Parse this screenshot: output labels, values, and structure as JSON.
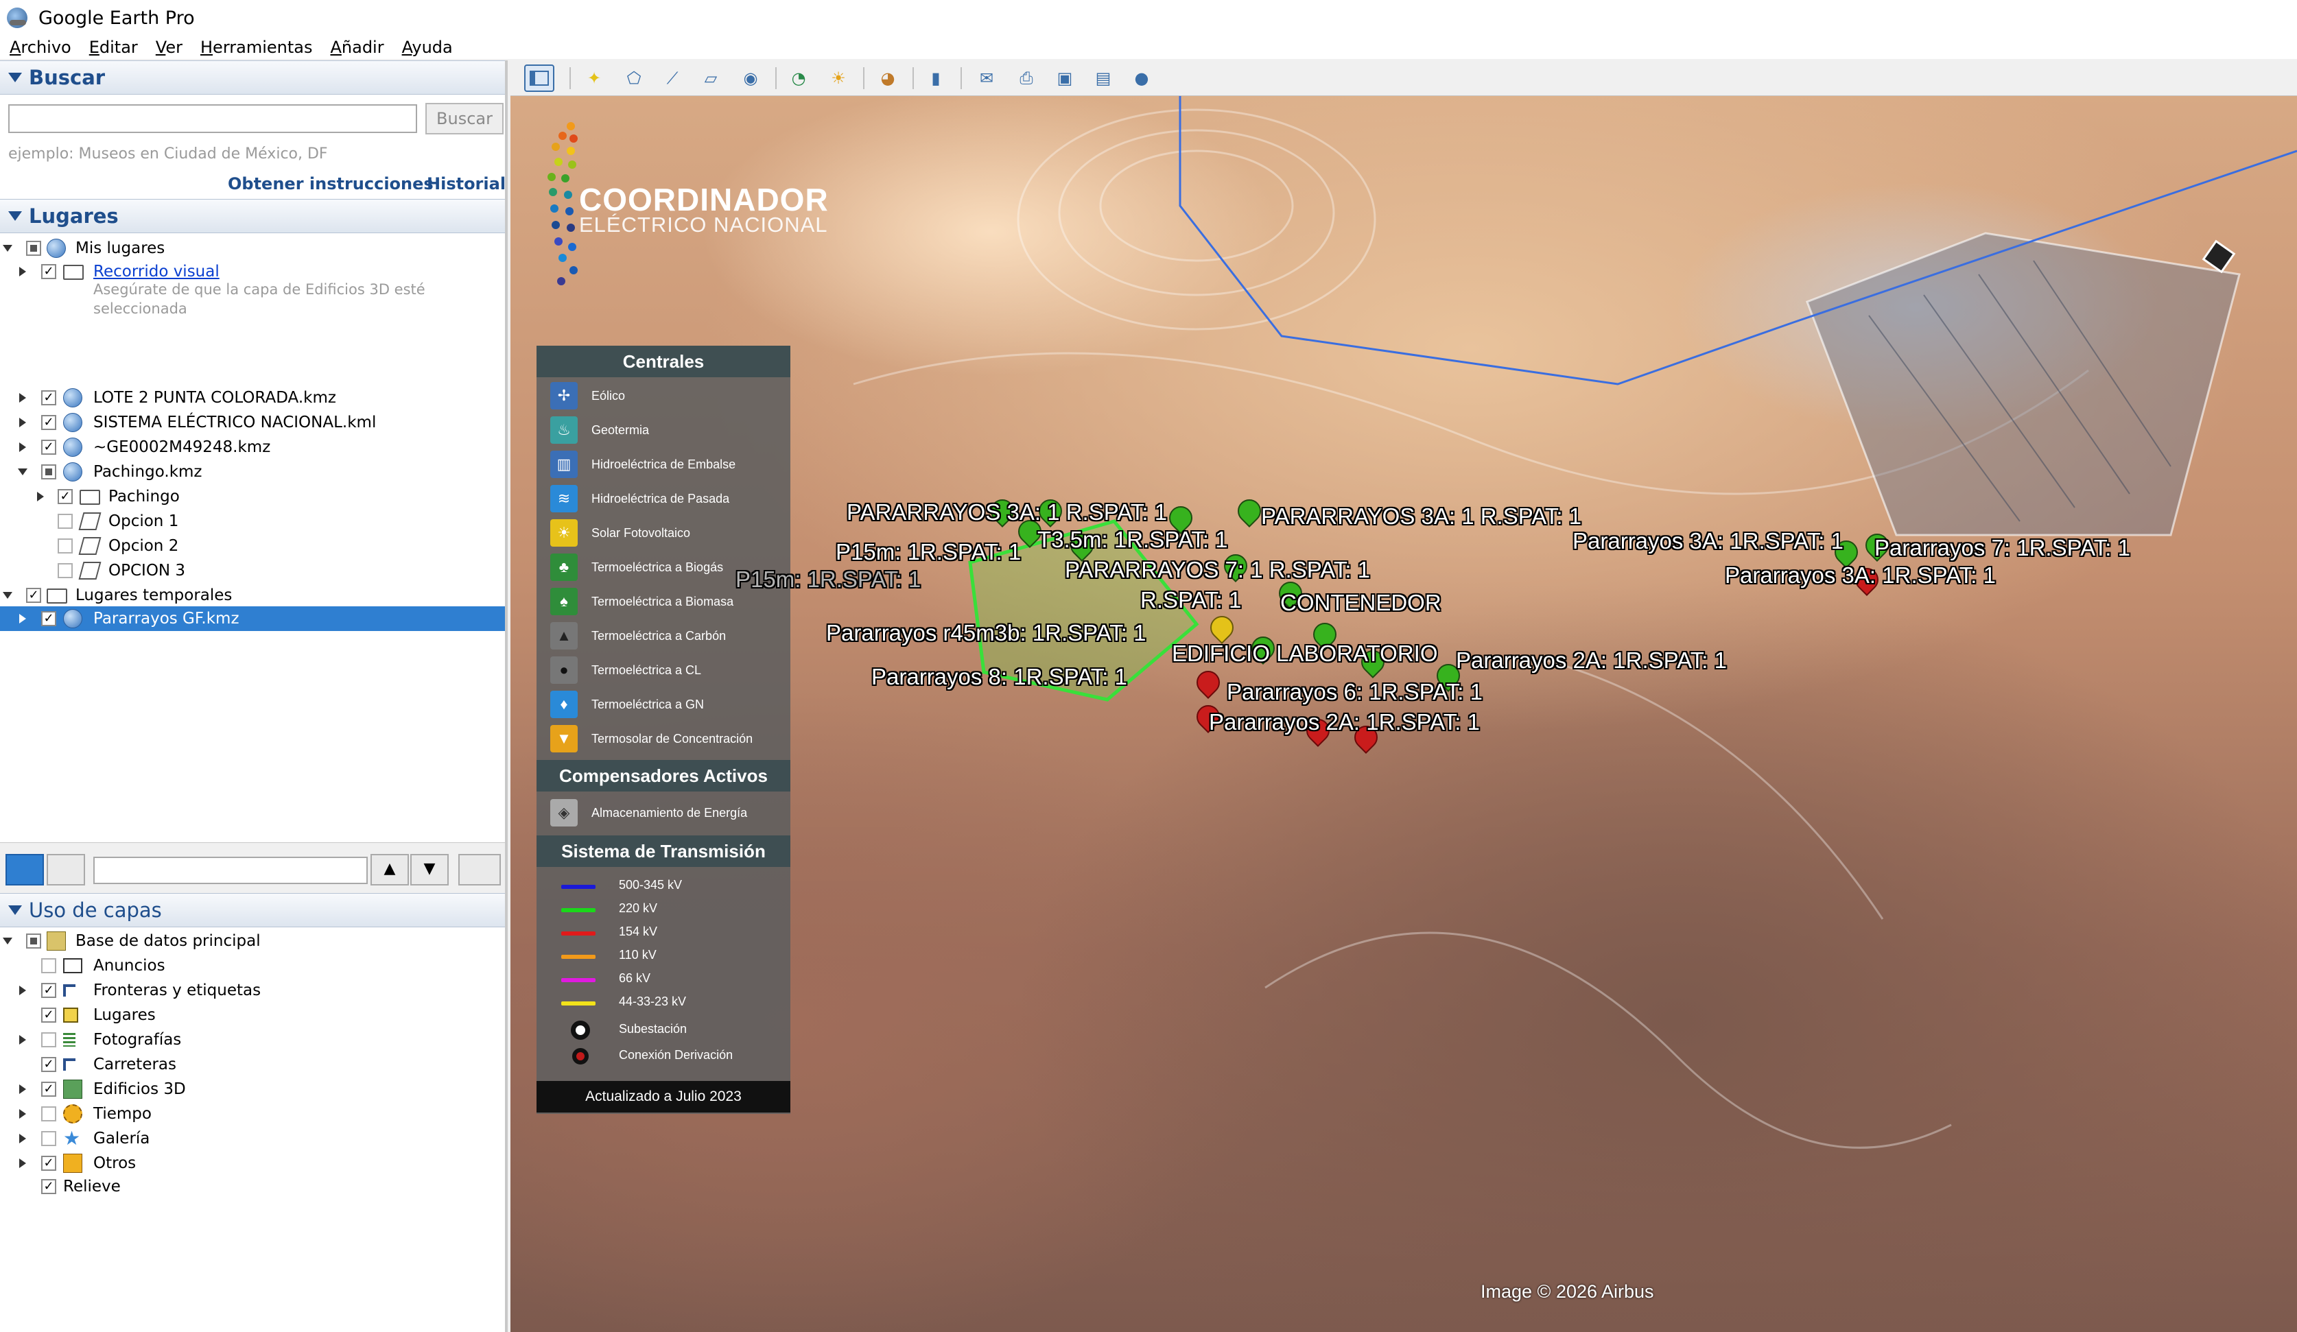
{
  "window": {
    "title": "Google Earth Pro"
  },
  "menu": [
    "Archivo",
    "Editar",
    "Ver",
    "Herramientas",
    "Añadir",
    "Ayuda"
  ],
  "search": {
    "header": "Buscar",
    "value": "",
    "button": "Buscar",
    "example": "ejemplo: Museos en Ciudad de México, DF",
    "directions": "Obtener instrucciones",
    "history": "Historial"
  },
  "places": {
    "header": "Lugares",
    "items": [
      {
        "label": "Mis lugares",
        "checked": "partial"
      },
      {
        "label": "Recorrido visual",
        "checked": true,
        "link": true
      },
      {
        "label": "Asegúrate de que la capa de Edificios 3D esté seleccionada",
        "hint": true
      },
      {
        "label": "LOTE 2 PUNTA COLORADA.kmz",
        "checked": true
      },
      {
        "label": "SISTEMA ELÉCTRICO NACIONAL.kml",
        "checked": true
      },
      {
        "label": "~GE0002M49248.kmz",
        "checked": true
      },
      {
        "label": "Pachingo.kmz",
        "checked": "partial"
      },
      {
        "label": "Pachingo",
        "checked": true
      },
      {
        "label": "Opcion 1",
        "checked": false
      },
      {
        "label": "Opcion 2",
        "checked": false
      },
      {
        "label": "OPCION 3",
        "checked": false
      },
      {
        "label": "Lugares temporales",
        "checked": true
      },
      {
        "label": "Pararrayos GF.kmz",
        "checked": true,
        "selected": true
      }
    ]
  },
  "layers": {
    "header": "Uso de capas",
    "items": [
      {
        "label": "Base de datos principal",
        "checked": "partial"
      },
      {
        "label": "Anuncios",
        "checked": false
      },
      {
        "label": "Fronteras y etiquetas",
        "checked": true
      },
      {
        "label": "Lugares",
        "checked": true
      },
      {
        "label": "Fotografías",
        "checked": false
      },
      {
        "label": "Carreteras",
        "checked": true
      },
      {
        "label": "Edificios 3D",
        "checked": true
      },
      {
        "label": "Tiempo",
        "checked": false
      },
      {
        "label": "Galería",
        "checked": false
      },
      {
        "label": "Otros",
        "checked": true
      },
      {
        "label": "Relieve",
        "checked": true
      }
    ]
  },
  "overlay": {
    "logo_title": "COORDINADOR",
    "logo_subtitle": "ELÉCTRICO NACIONAL"
  },
  "legend": {
    "centrales_header": "Centrales",
    "centrales": [
      {
        "label": "Eólico",
        "color": "#3b6fb6"
      },
      {
        "label": "Geotermia",
        "color": "#3aa0a0"
      },
      {
        "label": "Hidroeléctrica de Embalse",
        "color": "#3b6fb6"
      },
      {
        "label": "Hidroeléctrica de Pasada",
        "color": "#2a8ad8"
      },
      {
        "label": "Solar Fotovoltaico",
        "color": "#e7c21a"
      },
      {
        "label": "Termoeléctrica a Biogás",
        "color": "#2f8d3a"
      },
      {
        "label": "Termoeléctrica a Biomasa",
        "color": "#2f8d3a"
      },
      {
        "label": "Termoeléctrica a Carbón",
        "color": "#222222"
      },
      {
        "label": "Termoeléctrica a CL",
        "color": "#222222"
      },
      {
        "label": "Termoeléctrica a GN",
        "color": "#2a8ad8"
      },
      {
        "label": "Termosolar de Concentración",
        "color": "#e7a21a"
      }
    ],
    "compensadores_header": "Compensadores Activos",
    "compensadores": [
      {
        "label": "Almacenamiento de Energía",
        "color": "#888888"
      }
    ],
    "transmision_header": "Sistema de Transmisión",
    "lines": [
      {
        "label": "500-345 kV",
        "color": "#1a1ad8"
      },
      {
        "label": "220 kV",
        "color": "#1ad81a"
      },
      {
        "label": "154 kV",
        "color": "#e01a1a"
      },
      {
        "label": "110 kV",
        "color": "#f29a1a"
      },
      {
        "label": "66 kV",
        "color": "#e01ae0"
      },
      {
        "label": "44-33-23 kV",
        "color": "#f2e21a"
      }
    ],
    "subestacion": "Subestación",
    "derivacion": "Conexión Derivación",
    "updated": "Actualizado a Julio 2023"
  },
  "map_labels": [
    "PARARRAYOS 3A: 1 R.SPAT: 1",
    "PARARRAYOS 3A: 1 R.SPAT: 1",
    "P15m: 1R.SPAT: 1",
    "T3.5m: 1R.SPAT: 1",
    "P15m: 1R.SPAT: 1",
    "PARARRAYOS 7: 1 R.SPAT: 1",
    "R.SPAT: 1",
    "CONTENEDOR",
    "Pararrayos r45m3b: 1R.SPAT: 1",
    "EDIFICIO LABORATORIO",
    "Pararrayos 2A: 1R.SPAT: 1",
    "Pararrayos 8: 1R.SPAT: 1",
    "Pararrayos 6: 1R.SPAT: 1",
    "Pararrayos 2A: 1R.SPAT: 1",
    "Pararrayos 3A: 1R.SPAT: 1",
    "Pararrayos 7: 1R.SPAT: 1",
    "Pararrayos 3A: 1R.SPAT: 1"
  ],
  "credit": "Image © 2026 Airbus"
}
